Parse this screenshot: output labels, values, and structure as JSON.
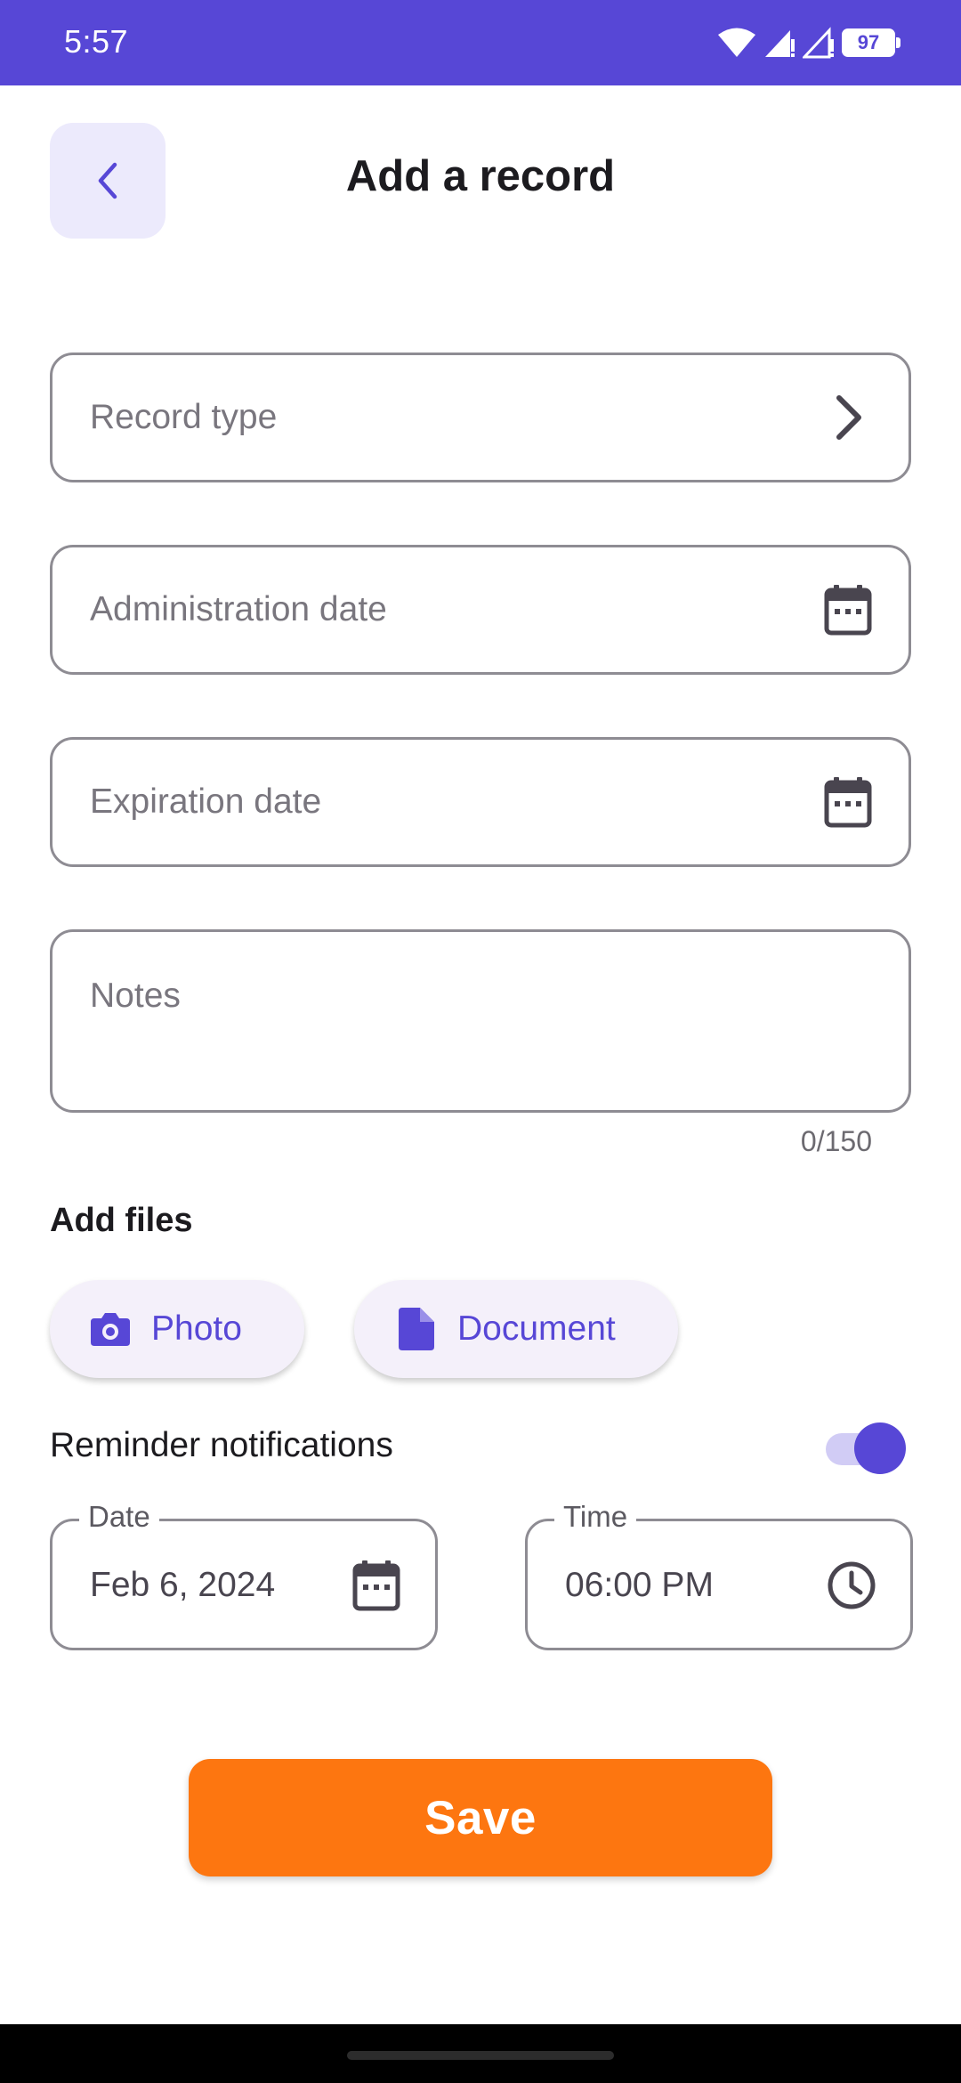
{
  "status_bar": {
    "time": "5:57",
    "battery": "97",
    "icons": [
      "wifi-icon",
      "signal-icon",
      "signal-icon",
      "battery-icon"
    ]
  },
  "header": {
    "title": "Add a record",
    "back_icon": "chevron-left-icon"
  },
  "form": {
    "record_type": {
      "placeholder": "Record type",
      "icon": "chevron-right-icon"
    },
    "administration_date": {
      "placeholder": "Administration date",
      "icon": "calendar-icon"
    },
    "expiration_date": {
      "placeholder": "Expiration date",
      "icon": "calendar-icon"
    },
    "notes": {
      "placeholder": "Notes",
      "counter": "0/150"
    }
  },
  "files": {
    "label": "Add files",
    "photo": {
      "label": "Photo",
      "icon": "camera-icon"
    },
    "document": {
      "label": "Document",
      "icon": "document-icon"
    }
  },
  "reminder": {
    "label": "Reminder notifications",
    "enabled": true,
    "date": {
      "legend": "Date",
      "value": "Feb 6, 2024",
      "icon": "calendar-icon"
    },
    "time": {
      "legend": "Time",
      "value": "06:00 PM",
      "icon": "clock-icon"
    }
  },
  "actions": {
    "save_label": "Save"
  },
  "colors": {
    "primary": "#5747d6",
    "primary_container": "#eceafc",
    "chip_bg": "#f4f0fa",
    "save": "#fd7610",
    "outline": "#8e8c93"
  }
}
